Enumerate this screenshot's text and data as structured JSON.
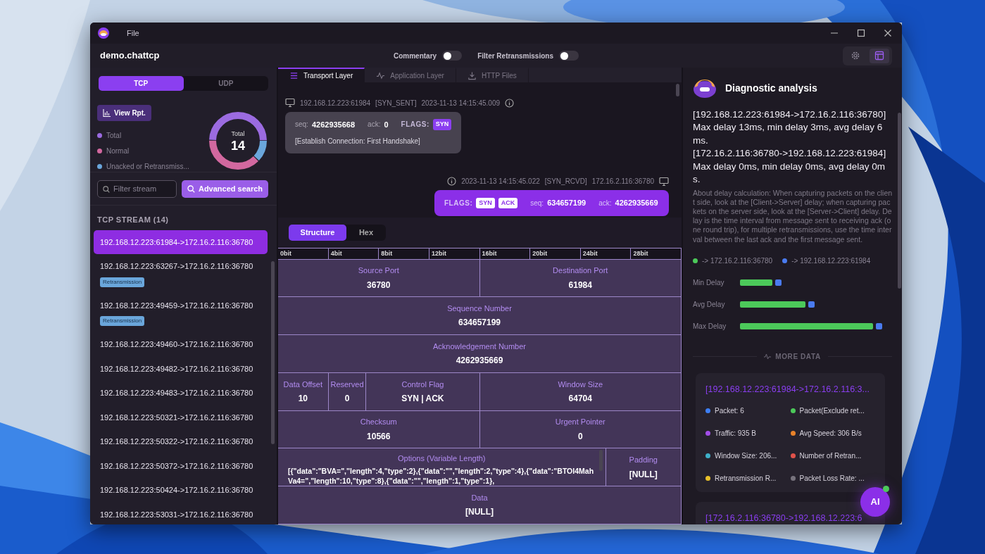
{
  "window": {
    "menu": [
      "File"
    ],
    "title": "demo.chattcp",
    "toggles": [
      {
        "label": "Commentary",
        "on": false
      },
      {
        "label": "Filter Retransmissions",
        "on": false
      }
    ],
    "toolbar": [
      {
        "kind": "settings",
        "selected": false
      },
      {
        "kind": "layout",
        "selected": true
      }
    ]
  },
  "protocol_tabs": [
    {
      "label": "TCP",
      "selected": true
    },
    {
      "label": "UDP",
      "selected": false
    }
  ],
  "summary": {
    "report_button": "View Rpt.",
    "donut_label": "Total",
    "donut_value": "14",
    "legend": [
      {
        "label": "Total",
        "color": "#9b6be0"
      },
      {
        "label": "Normal",
        "color": "#d2689f"
      },
      {
        "label": "Unacked or Retransmiss...",
        "color": "#6aa6db"
      }
    ]
  },
  "filter": {
    "placeholder": "Filter stream",
    "advanced_button": "Advanced search"
  },
  "streams": {
    "heading": "TCP STREAM (14)",
    "items": [
      {
        "label": "192.168.12.223:61984->172.16.2.116:36780",
        "selected": true
      },
      {
        "label": "192.168.12.223:63267->172.16.2.116:36780",
        "selected": false,
        "tag": "Retransmission"
      },
      {
        "label": "192.168.12.223:49459->172.16.2.116:36780",
        "selected": false,
        "tag": "Retransmission"
      },
      {
        "label": "192.168.12.223:49460->172.16.2.116:36780",
        "selected": false
      },
      {
        "label": "192.168.12.223:49482->172.16.2.116:36780",
        "selected": false
      },
      {
        "label": "192.168.12.223:49483->172.16.2.116:36780",
        "selected": false
      },
      {
        "label": "192.168.12.223:50321->172.16.2.116:36780",
        "selected": false
      },
      {
        "label": "192.168.12.223:50322->172.16.2.116:36780",
        "selected": false
      },
      {
        "label": "192.168.12.223:50372->172.16.2.116:36780",
        "selected": false
      },
      {
        "label": "192.168.12.223:50424->172.16.2.116:36780",
        "selected": false
      },
      {
        "label": "192.168.12.223:53031->172.16.2.116:36780",
        "selected": false
      }
    ]
  },
  "layer_tabs": [
    {
      "label": "Transport Layer",
      "kind": "list",
      "selected": true
    },
    {
      "label": "Application Layer",
      "kind": "pulse",
      "selected": false
    },
    {
      "label": "HTTP Files",
      "kind": "download",
      "selected": false
    }
  ],
  "messages": [
    {
      "kind": "sent",
      "meta": [
        "192.168.12.223:61984",
        "[SYN_SENT]",
        "2023-11-13 14:15:45.009"
      ],
      "fields": [
        {
          "label": "seq:",
          "value": "4262935668"
        },
        {
          "label": "ack:",
          "value": "0"
        },
        {
          "label": "FLAGS:",
          "flags": [
            "SYN"
          ]
        }
      ],
      "note": "[Establish Connection: First Handshake]"
    },
    {
      "kind": "received",
      "meta": [
        "2023-11-13 14:15:45.022",
        "[SYN_RCVD]",
        "172.16.2.116:36780"
      ],
      "fields": [
        {
          "label": "FLAGS:",
          "flags": [
            "SYN",
            "ACK"
          ]
        },
        {
          "label": "seq:",
          "value": "634657199"
        },
        {
          "label": "ack:",
          "value": "4262935669"
        }
      ]
    }
  ],
  "view_tabs": [
    {
      "label": "Structure",
      "selected": true
    },
    {
      "label": "Hex",
      "selected": false
    }
  ],
  "bit_ruler": [
    "0bit",
    "4bit",
    "8bit",
    "12bit",
    "16bit",
    "20bit",
    "24bit",
    "28bit"
  ],
  "header_rows": [
    [
      {
        "kind": "half",
        "label": "Source Port",
        "value": "36780"
      },
      {
        "kind": "half",
        "label": "Destination Port",
        "value": "61984"
      }
    ],
    [
      {
        "kind": "full",
        "label": "Sequence Number",
        "value": "634657199"
      }
    ],
    [
      {
        "kind": "full",
        "label": "Acknowledgement Number",
        "value": "4262935669"
      }
    ],
    [
      {
        "kind": "offset",
        "label": "Data Offset",
        "value": "10"
      },
      {
        "kind": "reserved",
        "label": "Reserved",
        "value": "0"
      },
      {
        "kind": "flags",
        "label": "Control Flag",
        "value": "SYN | ACK"
      },
      {
        "kind": "half",
        "label": "Window Size",
        "value": "64704"
      }
    ],
    [
      {
        "kind": "half",
        "label": "Checksum",
        "value": "10566"
      },
      {
        "kind": "half",
        "label": "Urgent Pointer",
        "value": "0"
      }
    ],
    [
      {
        "kind": "options",
        "label": "Options  (Variable Length)",
        "value": "[{\"data\":\"BVA=\",\"length\":4,\"type\":2},{\"data\":\"\",\"length\":2,\"type\":4},{\"data\":\"BTOI4MahVa4=\",\"length\":10,\"type\":8},{\"data\":\"\",\"length\":1,\"type\":1},"
      },
      {
        "kind": "padding",
        "label": "Padding",
        "value": "[NULL]"
      }
    ],
    [
      {
        "kind": "full",
        "label": "Data",
        "value": "[NULL]"
      }
    ]
  ],
  "diagnosis": {
    "title": "Diagnostic analysis",
    "delays": [
      {
        "route": "[192.168.12.223:61984->172.16.2.116:36780]",
        "text": "Max delay 13ms, min delay 3ms, avg delay 6ms."
      },
      {
        "route": "[172.16.2.116:36780->192.168.12.223:61984]",
        "text": "Max delay 0ms, min delay 0ms, avg delay 0ms."
      }
    ],
    "note": "About delay calculation: When capturing packets on the client side, look at the [Client->Server] delay; when capturing packets on the server side, look at the [Server->Client] delay. Delay is the time interval from message sent to receiving ack (one round trip), for multiple retransmissions, use the time interval between the last ack and the first message sent.",
    "legend": [
      {
        "label": "-> 172.16.2.116:36780",
        "color": "#4cc95a"
      },
      {
        "label": "-> 192.168.12.223:61984",
        "color": "#4a7bf0"
      }
    ],
    "bars": [
      {
        "label": "Min Delay"
      },
      {
        "label": "Avg Delay"
      },
      {
        "label": "Max Delay"
      }
    ],
    "more_label": "MORE DATA",
    "cards": [
      {
        "title": "[192.168.12.223:61984->172.16.2.116:3...",
        "stats": [
          {
            "label": "Packet: 6",
            "color": "#3d7ff5"
          },
          {
            "label": "Packet(Exclude ret...",
            "color": "#4cc95a"
          },
          {
            "label": "Traffic: 935 B",
            "color": "#a24ee8"
          },
          {
            "label": "Avg Speed: 306 B/s",
            "color": "#e8822a"
          },
          {
            "label": "Window Size: 206...",
            "color": "#3eb0c9"
          },
          {
            "label": "Number of Retran...",
            "color": "#e0524a"
          },
          {
            "label": "Retransmission R...",
            "color": "#e8c02a"
          },
          {
            "label": "Packet Loss Rate: ...",
            "color": "#77737d"
          }
        ]
      },
      {
        "title": "[172.16.2.116:36780->192.168.12.223:6"
      }
    ]
  },
  "assistant_button": "AI"
}
